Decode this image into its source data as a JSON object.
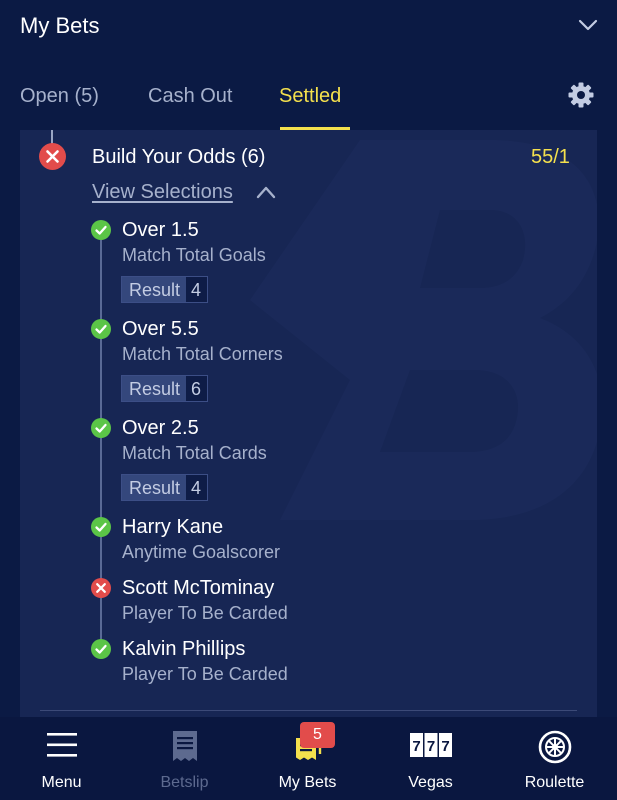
{
  "header": {
    "title": "My Bets",
    "chevron_icon": "chevron-down-icon"
  },
  "tabs": [
    {
      "label": "Open (5)",
      "active": false
    },
    {
      "label": "Cash Out",
      "active": false
    },
    {
      "label": "Settled",
      "active": true
    }
  ],
  "settings_icon": "gear-icon",
  "bet": {
    "status": "lost",
    "title": "Build Your Odds (6)",
    "odds": "55/1",
    "view_selections_label": "View Selections",
    "selections": [
      {
        "name": "Over 1.5",
        "market": "Match Total Goals",
        "result_label": "Result",
        "result_value": "4",
        "status": "won"
      },
      {
        "name": "Over 5.5",
        "market": "Match Total Corners",
        "result_label": "Result",
        "result_value": "6",
        "status": "won"
      },
      {
        "name": "Over 2.5",
        "market": "Match Total Cards",
        "result_label": "Result",
        "result_value": "4",
        "status": "won"
      },
      {
        "name": "Harry Kane",
        "market": "Anytime Goalscorer",
        "status": "won"
      },
      {
        "name": "Scott McTominay",
        "market": "Player To Be Carded",
        "status": "lost"
      },
      {
        "name": "Kalvin Phillips",
        "market": "Player To Be Carded",
        "status": "won"
      }
    ]
  },
  "colors": {
    "background": "#0b1a44",
    "card": "#172654",
    "accent_yellow": "#f4e04d",
    "won_green": "#5bc547",
    "lost_red": "#e24c4b",
    "muted_text": "#a6b1cc"
  },
  "bottom_nav": {
    "items": [
      {
        "label": "Menu",
        "icon": "menu-icon",
        "enabled": true
      },
      {
        "label": "Betslip",
        "icon": "betslip-icon",
        "enabled": false
      },
      {
        "label": "My Bets",
        "icon": "my-bets-icon",
        "enabled": true
      },
      {
        "label": "Vegas",
        "icon": "vegas-777-icon",
        "enabled": true
      },
      {
        "label": "Roulette",
        "icon": "roulette-icon",
        "enabled": true
      }
    ],
    "my_bets_badge": "5"
  }
}
